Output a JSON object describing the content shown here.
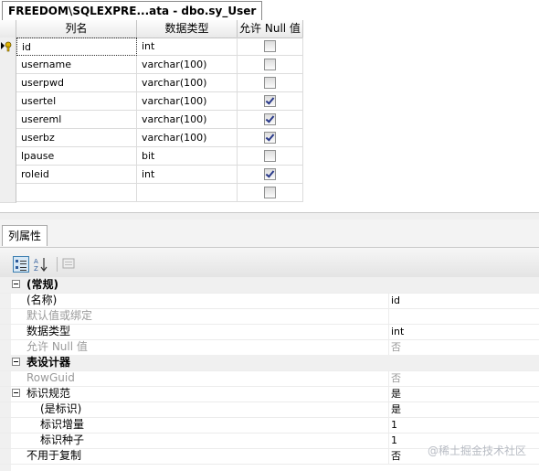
{
  "document_tab": {
    "title": "FREEDOM\\SQLEXPRE...ata - dbo.sy_User"
  },
  "grid": {
    "headers": {
      "name": "列名",
      "type": "数据类型",
      "null": "允许 Null 值"
    },
    "rows": [
      {
        "name": "id",
        "type": "int",
        "allow_null": false,
        "primary_key": true,
        "selected": true
      },
      {
        "name": "username",
        "type": "varchar(100)",
        "allow_null": false
      },
      {
        "name": "userpwd",
        "type": "varchar(100)",
        "allow_null": false
      },
      {
        "name": "usertel",
        "type": "varchar(100)",
        "allow_null": true
      },
      {
        "name": "usereml",
        "type": "varchar(100)",
        "allow_null": true
      },
      {
        "name": "userbz",
        "type": "varchar(100)",
        "allow_null": true
      },
      {
        "name": "lpause",
        "type": "bit",
        "allow_null": false
      },
      {
        "name": "roleid",
        "type": "int",
        "allow_null": true
      },
      {
        "name": "",
        "type": "",
        "allow_null": false
      }
    ]
  },
  "properties": {
    "tab_label": "列属性",
    "toolbar": {
      "categorized_icon": "categorized-icon",
      "alphabetical_icon": "sort-az-icon",
      "pages_icon": "property-pages-icon"
    },
    "items": [
      {
        "kind": "category",
        "name": "(常规)"
      },
      {
        "kind": "prop",
        "name": "(名称)",
        "value": "id",
        "indent": 1,
        "gray": false
      },
      {
        "kind": "prop",
        "name": "默认值或绑定",
        "value": "",
        "indent": 1,
        "gray": true
      },
      {
        "kind": "prop",
        "name": "数据类型",
        "value": "int",
        "indent": 1,
        "gray": false
      },
      {
        "kind": "prop",
        "name": "允许 Null 值",
        "value": "否",
        "indent": 1,
        "gray": true
      },
      {
        "kind": "category",
        "name": "表设计器"
      },
      {
        "kind": "prop",
        "name": "RowGuid",
        "value": "否",
        "indent": 1,
        "gray": true
      },
      {
        "kind": "subcategory",
        "name": "标识规范",
        "value": "是",
        "indent": 1
      },
      {
        "kind": "prop",
        "name": "(是标识)",
        "value": "是",
        "indent": 2,
        "gray": false
      },
      {
        "kind": "prop",
        "name": "标识增量",
        "value": "1",
        "indent": 2,
        "gray": false
      },
      {
        "kind": "prop",
        "name": "标识种子",
        "value": "1",
        "indent": 2,
        "gray": false
      },
      {
        "kind": "prop",
        "name": "不用于复制",
        "value": "否",
        "indent": 1,
        "gray": false
      }
    ]
  },
  "watermark": "@稀土掘金技术社区"
}
